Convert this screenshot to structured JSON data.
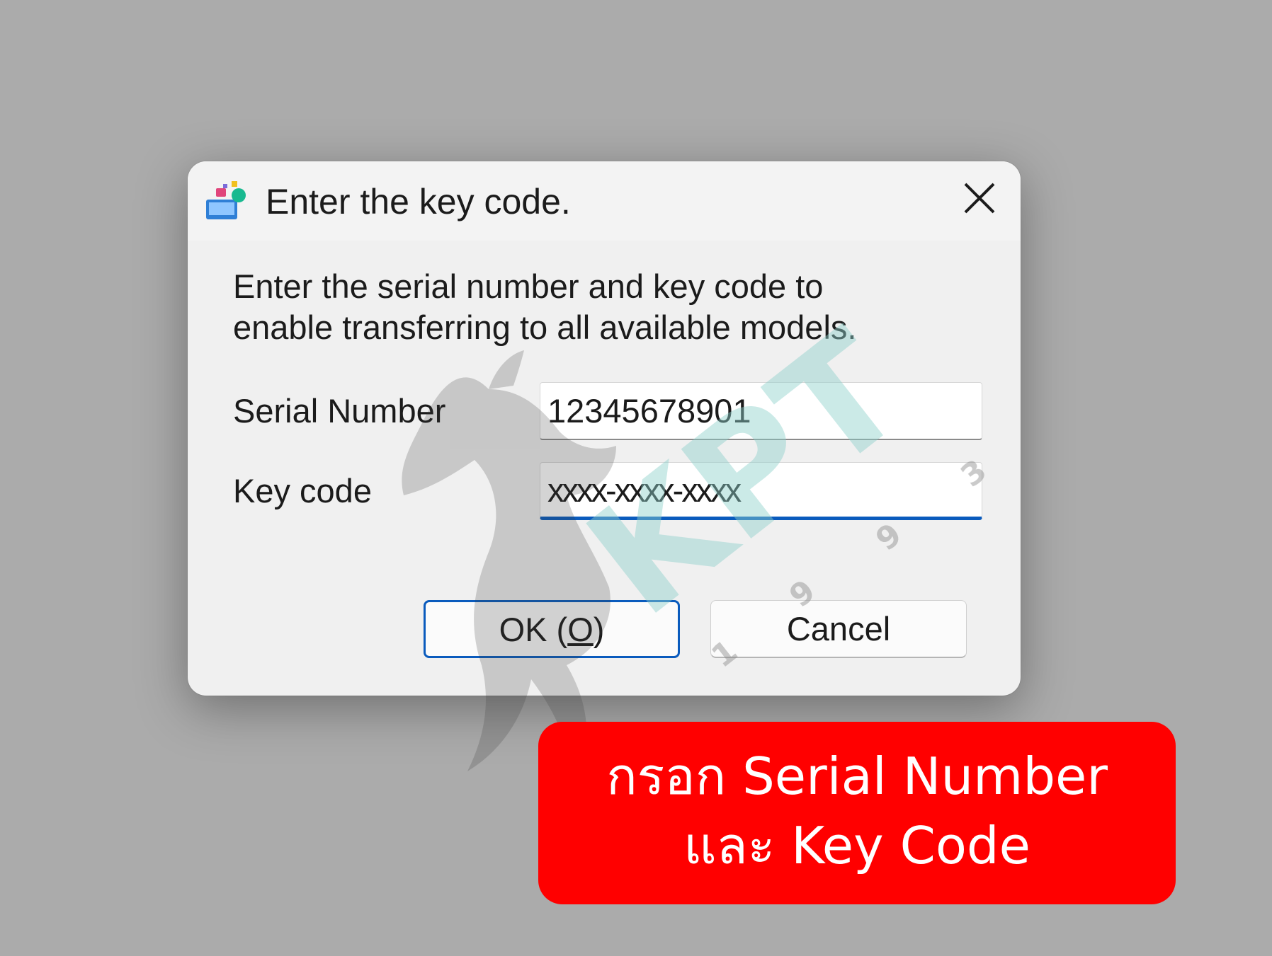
{
  "dialog": {
    "title": "Enter the key code.",
    "app_icon": "transfer-app-icon",
    "close_icon": "close-icon",
    "instructions": {
      "line1": "Enter the serial number and key code to",
      "line2": "enable transferring to all available models."
    },
    "serial_number": {
      "label": "Serial Number",
      "value": "12345678901"
    },
    "key_code": {
      "label": "Key code",
      "value": "xxxx-xxxx-xxxx"
    },
    "buttons": {
      "ok_prefix": "OK (",
      "ok_mnemonic": "O",
      "ok_suffix": ")",
      "cancel": "Cancel"
    },
    "accent_color": "#0a5bbd"
  },
  "watermark": {
    "brand": "KPT",
    "digits": [
      "1",
      "9",
      "9",
      "3"
    ],
    "logo_icon": "horse-silhouette-icon"
  },
  "callout": {
    "line1": "กรอก Serial Number",
    "line2": "และ Key Code",
    "color": "#ff0000"
  }
}
